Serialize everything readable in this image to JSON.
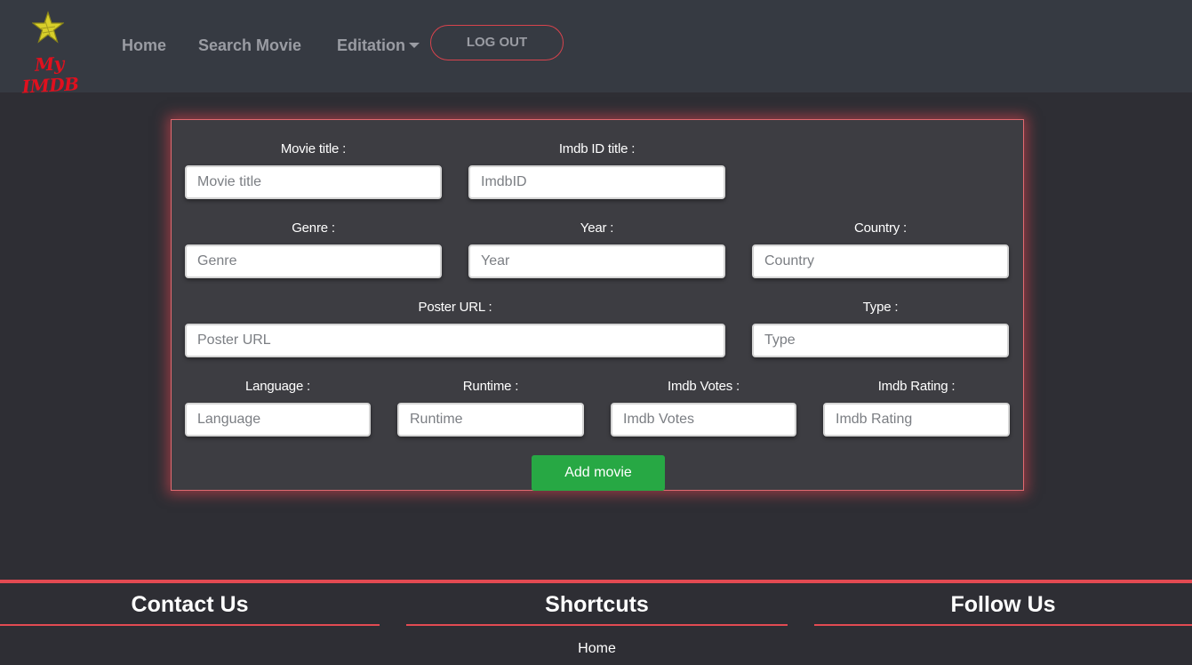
{
  "brand": {
    "logo_text": "My IMDB",
    "star_color": "#d8cf2a",
    "text_color": "#e0101e"
  },
  "nav": {
    "home": "Home",
    "search": "Search Movie",
    "edit": "Editation",
    "logout": "LOG OUT"
  },
  "form": {
    "movie_title": {
      "label": "Movie title :",
      "placeholder": "Movie title"
    },
    "imdb_id": {
      "label": "Imdb ID title :",
      "placeholder": "ImdbID"
    },
    "genre": {
      "label": "Genre :",
      "placeholder": "Genre"
    },
    "year": {
      "label": "Year :",
      "placeholder": "Year"
    },
    "country": {
      "label": "Country :",
      "placeholder": "Country"
    },
    "poster_url": {
      "label": "Poster URL :",
      "placeholder": "Poster URL"
    },
    "type": {
      "label": "Type :",
      "placeholder": "Type"
    },
    "language": {
      "label": "Language :",
      "placeholder": "Language"
    },
    "runtime": {
      "label": "Runtime :",
      "placeholder": "Runtime"
    },
    "imdb_votes": {
      "label": "Imdb Votes :",
      "placeholder": "Imdb Votes"
    },
    "imdb_rating": {
      "label": "Imdb Rating :",
      "placeholder": "Imdb Rating"
    },
    "submit_label": "Add movie"
  },
  "footer": {
    "contact_title": "Contact Us",
    "shortcuts_title": "Shortcuts",
    "follow_title": "Follow Us",
    "shortcut_home": "Home"
  },
  "colors": {
    "accent": "#e24a52",
    "submit": "#27a844",
    "background": "#2e2e34",
    "navbar": "#363a42"
  }
}
